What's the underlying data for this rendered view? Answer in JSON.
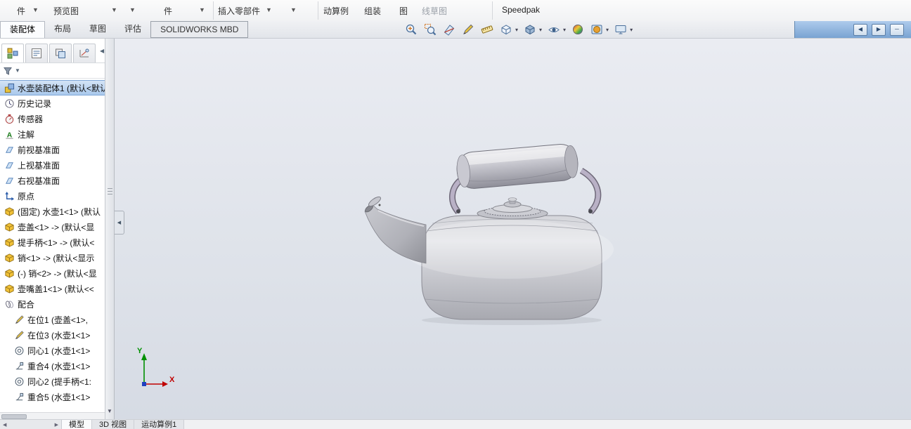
{
  "colors": {
    "selection": "#aac9ec",
    "titlebar_blue": "#8fb4dd",
    "viewport_top": "#eaecf2",
    "viewport_bottom": "#d6dbe4",
    "part_icon_yellow": "#f2c237"
  },
  "ribbon": {
    "fragments": [
      "件",
      "预览图",
      "件",
      "插入零部件",
      "动算例",
      "组装",
      "图",
      "线草图",
      "Speedpak"
    ]
  },
  "command_tabs": {
    "items": [
      {
        "label": "装配体",
        "active": true
      },
      {
        "label": "布局",
        "active": false
      },
      {
        "label": "草图",
        "active": false
      },
      {
        "label": "评估",
        "active": false
      },
      {
        "label": "SOLIDWORKS MBD",
        "active": false
      }
    ]
  },
  "hud_toolbar": {
    "icons": [
      {
        "name": "zoom-to-fit",
        "sym": "zoomfit",
        "caret": false
      },
      {
        "name": "zoom-to-area",
        "sym": "zoomarea",
        "caret": false
      },
      {
        "name": "section-view",
        "sym": "section",
        "caret": false
      },
      {
        "name": "dynamic-annotation",
        "sym": "annotate3d",
        "caret": false
      },
      {
        "name": "measure",
        "sym": "measure",
        "caret": false
      },
      {
        "name": "view-orientation",
        "sym": "vieworient",
        "caret": true
      },
      {
        "name": "display-style",
        "sym": "displaystyle",
        "caret": true
      },
      {
        "name": "hide-show-items",
        "sym": "eye",
        "caret": true
      },
      {
        "name": "edit-appearance",
        "sym": "appearance",
        "caret": false
      },
      {
        "name": "apply-scene",
        "sym": "scene",
        "caret": true
      },
      {
        "name": "view-settings",
        "sym": "monitor",
        "caret": true
      }
    ]
  },
  "window_controls": [
    "restore-left",
    "restore-right",
    "minimize"
  ],
  "panel_tabs": {
    "icons": [
      {
        "name": "featuremanager",
        "sym": "fmtree"
      },
      {
        "name": "propertymanager",
        "sym": "proplist"
      },
      {
        "name": "configurationmanager",
        "sym": "config"
      },
      {
        "name": "dimxpertmanager",
        "sym": "dimx"
      }
    ]
  },
  "feature_tree": {
    "items": [
      {
        "icon": "assembly",
        "label": "水壶装配体1 (默认<默认",
        "selected": true,
        "indent": 0
      },
      {
        "icon": "history",
        "label": "历史记录",
        "indent": 0
      },
      {
        "icon": "sensor",
        "label": "传感器",
        "indent": 0
      },
      {
        "icon": "annotation",
        "label": "注解",
        "indent": 0
      },
      {
        "icon": "plane",
        "label": "前视基准面",
        "indent": 0
      },
      {
        "icon": "plane",
        "label": "上视基准面",
        "indent": 0
      },
      {
        "icon": "plane",
        "label": "右视基准面",
        "indent": 0
      },
      {
        "icon": "origin",
        "label": "原点",
        "indent": 0
      },
      {
        "icon": "part",
        "label": "(固定) 水壶1<1> (默认",
        "indent": 0
      },
      {
        "icon": "part",
        "label": "壶盖<1> -> (默认<显",
        "indent": 0
      },
      {
        "icon": "part",
        "label": "提手柄<1> -> (默认<",
        "indent": 0
      },
      {
        "icon": "part",
        "label": "销<1> -> (默认<显示",
        "indent": 0
      },
      {
        "icon": "part",
        "label": "(-) 销<2> -> (默认<显",
        "indent": 0
      },
      {
        "icon": "part",
        "label": "壶嘴盖1<1> (默认<<",
        "indent": 0
      },
      {
        "icon": "mates",
        "label": "配合",
        "indent": 0
      },
      {
        "icon": "inplace",
        "label": "在位1 (壶盖<1>,",
        "indent": 1
      },
      {
        "icon": "inplace",
        "label": "在位3 (水壶1<1>",
        "indent": 1
      },
      {
        "icon": "concentric",
        "label": "同心1 (水壶1<1>",
        "indent": 1
      },
      {
        "icon": "coincident",
        "label": "重合4 (水壶1<1>",
        "indent": 1
      },
      {
        "icon": "concentric",
        "label": "同心2 (提手柄<1:",
        "indent": 1
      },
      {
        "icon": "coincident",
        "label": "重合5 (水壶1<1>",
        "indent": 1
      }
    ]
  },
  "viewport": {
    "model_name": "kettle-assembly",
    "triad": {
      "x_label": "X",
      "y_label": "Y"
    }
  },
  "status_bar": {
    "tabs": [
      {
        "label": "模型",
        "active": true
      },
      {
        "label": "3D 视图",
        "active": false
      },
      {
        "label": "运动算例1",
        "active": false
      }
    ]
  }
}
